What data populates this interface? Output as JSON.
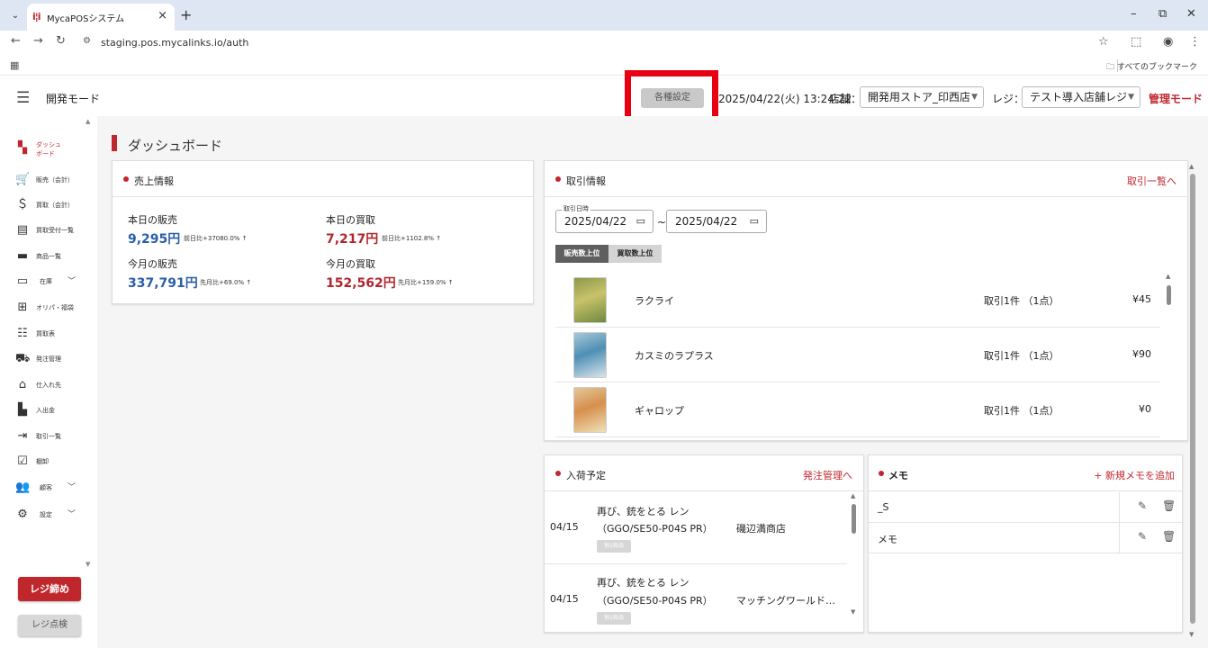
{
  "browser": {
    "tab_title": "MycaPOSシステム",
    "tab_close": "×",
    "new_tab": "+",
    "url": "staging.pos.mycalinks.io/auth",
    "bookmarks_folder": "すべてのブックマーク"
  },
  "header": {
    "mode_title": "開発モード",
    "settings_button": "各種設定",
    "datetime": "2025/04/22(火) 13:24:22",
    "store_label": "店舗：",
    "store_value": "開発用ストア_印西店",
    "register_label": "レジ：",
    "register_value": "テスト導入店舗レジ",
    "admin_mode": "管理モード"
  },
  "sidebar": {
    "items": [
      {
        "label": "ダッシュボード",
        "icon": "dashboard-icon"
      },
      {
        "label": "販売（会計）",
        "icon": "cart-icon"
      },
      {
        "label": "買取（会計）",
        "icon": "dollar-icon"
      },
      {
        "label": "買取受付一覧",
        "icon": "receipt-icon"
      },
      {
        "label": "商品一覧",
        "icon": "store-icon"
      },
      {
        "label": "在庫",
        "icon": "inventory-icon"
      },
      {
        "label": "オリパ・福袋",
        "icon": "gift-box-icon"
      },
      {
        "label": "買取表",
        "icon": "list-icon"
      },
      {
        "label": "発注管理",
        "icon": "truck-icon"
      },
      {
        "label": "仕入れ先",
        "icon": "bank-icon"
      },
      {
        "label": "入出金",
        "icon": "cash-register-icon"
      },
      {
        "label": "取引一覧",
        "icon": "transactions-icon"
      },
      {
        "label": "棚卸",
        "icon": "checkbox-icon"
      },
      {
        "label": "顧客",
        "icon": "people-icon"
      },
      {
        "label": "設定",
        "icon": "gear-icon"
      }
    ],
    "close_register": "レジ締め",
    "check_register": "レジ点検"
  },
  "main": {
    "page_title": "ダッシュボード",
    "sales": {
      "title": "売上情報",
      "today_sales_label": "本日の販売",
      "today_sales_value": "9,295円",
      "today_sales_cmp": "前日比+37080.0% ↑",
      "today_buy_label": "本日の買取",
      "today_buy_value": "7,217円",
      "today_buy_cmp": "前日比+1102.8% ↑",
      "month_sales_label": "今月の販売",
      "month_sales_value": "337,791円",
      "month_sales_cmp": "先月比+69.0% ↑",
      "month_buy_label": "今月の買取",
      "month_buy_value": "152,562円",
      "month_buy_cmp": "先月比+159.0% ↑"
    },
    "transactions": {
      "title": "取引情報",
      "link": "取引一覧へ",
      "date_legend": "取引日時",
      "date_from": "2025/04/22",
      "date_to": "2025/04/22",
      "tilde": "~",
      "tab_sales_top": "販売数上位",
      "tab_buy_top": "買取数上位",
      "rows": [
        {
          "name": "ラクライ",
          "count": "取引1件 （1点）",
          "price": "¥45"
        },
        {
          "name": "カスミのラプラス",
          "count": "取引1件 （1点）",
          "price": "¥90"
        },
        {
          "name": "ギャロップ",
          "count": "取引1件 （1点）",
          "price": "¥0"
        }
      ]
    },
    "arrivals": {
      "title": "入荷予定",
      "link": "発注管理へ",
      "rows": [
        {
          "date": "04/15",
          "line1": "再び、銃をとる レン",
          "line2": "（GGO/SE50-P04S PR）",
          "shop": "磯辺満商店",
          "tag": "他1商品"
        },
        {
          "date": "04/15",
          "line1": "再び、銃をとる レン",
          "line2": "（GGO/SE50-P04S PR）",
          "shop": "マッチングワールド…",
          "tag": "他1商品"
        }
      ]
    },
    "memo": {
      "title": "メモ",
      "add": "+ 新規メモを追加",
      "items": [
        {
          "text": "_S"
        },
        {
          "text": "メモ"
        }
      ]
    }
  },
  "colors": {
    "accent": "#c0272d",
    "blue_value": "#2a5ea8",
    "highlight_box": "#e60012"
  }
}
